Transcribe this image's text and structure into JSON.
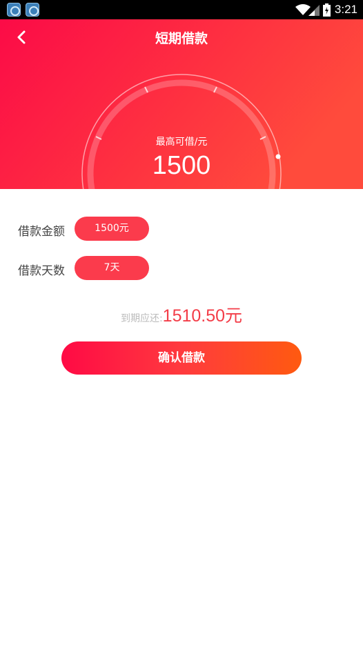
{
  "status_bar": {
    "time": "3:21",
    "app_icons": [
      "app-icon",
      "app-icon"
    ]
  },
  "header": {
    "title": "短期借款",
    "back_icon": "chevron-left-icon",
    "gradient_colors": [
      "#fc0b47",
      "#ff4b3c"
    ]
  },
  "gauge": {
    "label": "最高可借/元",
    "value": "1500"
  },
  "form": {
    "amount_label": "借款金额",
    "amount_value": "1500元",
    "days_label": "借款天数",
    "days_value": "7天"
  },
  "due": {
    "label": "到期应还:",
    "amount": "1510.50元"
  },
  "confirm_button": {
    "label": "确认借款",
    "gradient_colors": [
      "#ff0a45",
      "#ff5a10"
    ]
  }
}
